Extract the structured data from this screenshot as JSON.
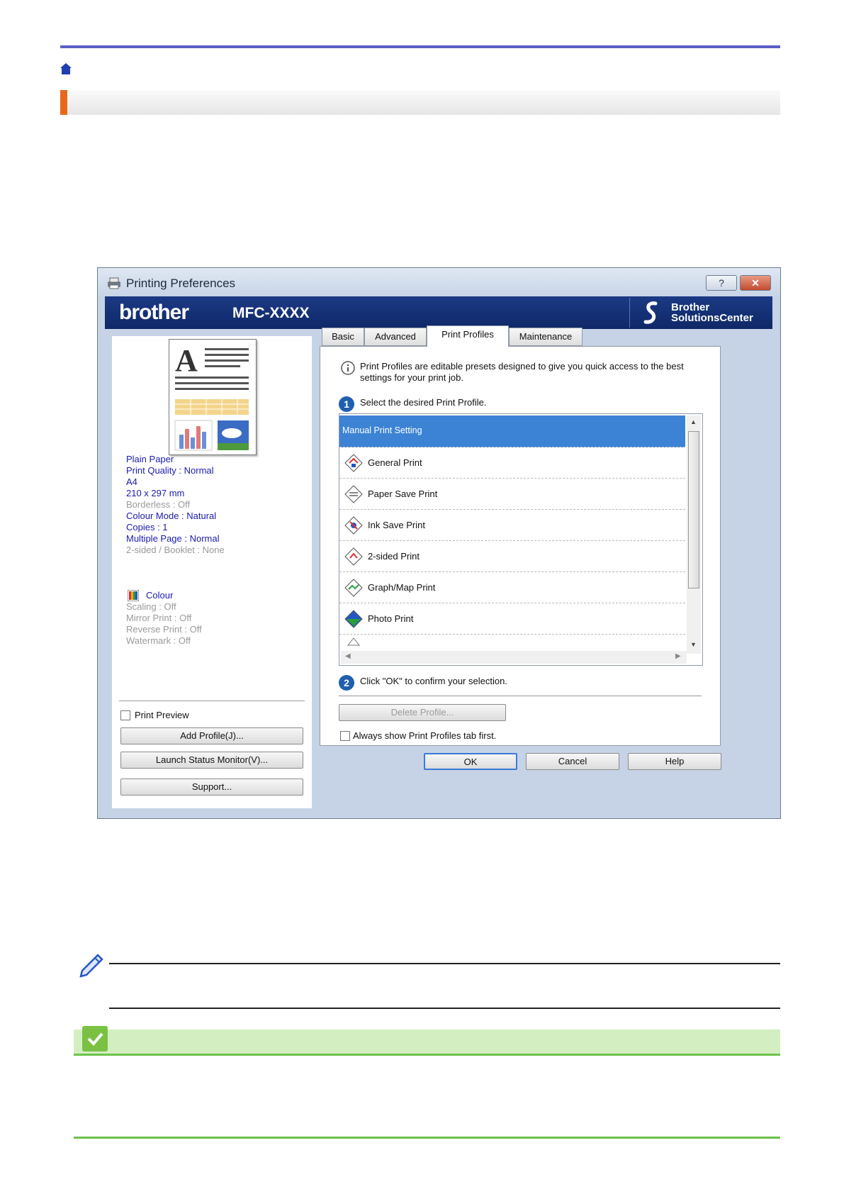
{
  "dialog": {
    "title": "Printing Preferences",
    "help_button": "?",
    "close_button": "✕",
    "brand": "brother",
    "model": "MFC-XXXX",
    "solutions_center": [
      "Brother",
      "SolutionsCenter"
    ]
  },
  "left_panel": {
    "settings": [
      {
        "text": "Plain Paper",
        "enabled": true
      },
      {
        "text": "Print Quality : Normal",
        "enabled": true
      },
      {
        "text": "A4",
        "enabled": true
      },
      {
        "text": "210 x 297 mm",
        "enabled": true
      },
      {
        "text": "Borderless : Off",
        "enabled": false
      },
      {
        "text": "Colour Mode : Natural",
        "enabled": true
      },
      {
        "text": "Copies : 1",
        "enabled": true
      },
      {
        "text": "Multiple Page : Normal",
        "enabled": true
      },
      {
        "text": "2-sided / Booklet : None",
        "enabled": false
      }
    ],
    "colour_label": "Colour",
    "extra_settings": [
      "Scaling : Off",
      "Mirror Print : Off",
      "Reverse Print : Off",
      "Watermark : Off"
    ],
    "print_preview": "Print Preview",
    "add_profile": "Add Profile(J)...",
    "launch_status_monitor": "Launch Status Monitor(V)...",
    "support": "Support..."
  },
  "tabs": [
    "Basic",
    "Advanced",
    "Print Profiles",
    "Maintenance"
  ],
  "active_tab": "Print Profiles",
  "profiles_tab": {
    "info": "Print Profiles are editable presets designed to give you quick access to the best settings for your print job.",
    "step1": "Select the desired Print Profile.",
    "profiles": [
      {
        "label": "Manual Print Setting",
        "selected": true
      },
      {
        "label": "General Print",
        "selected": false
      },
      {
        "label": "Paper Save Print",
        "selected": false
      },
      {
        "label": "Ink Save Print",
        "selected": false
      },
      {
        "label": "2-sided Print",
        "selected": false
      },
      {
        "label": "Graph/Map Print",
        "selected": false
      },
      {
        "label": "Photo Print",
        "selected": false
      }
    ],
    "step2": "Click \"OK\" to confirm your selection.",
    "delete_profile": "Delete Profile...",
    "always_show": "Always show Print Profiles tab first."
  },
  "buttons": {
    "ok": "OK",
    "cancel": "Cancel",
    "help": "Help"
  },
  "colors": {
    "accent": "#e9671d",
    "header_rule": "#5b5fc7",
    "related_green": "#6cc24a",
    "selection": "#3c83d5"
  }
}
